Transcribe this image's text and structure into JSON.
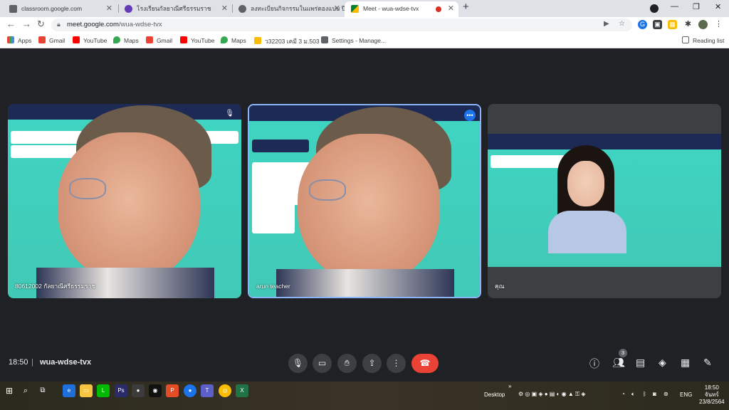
{
  "browser": {
    "tabs": [
      {
        "title": "classroom.google.com",
        "active": false
      },
      {
        "title": "โรงเรียนกัลยาณีศรีธรรมราช",
        "active": false
      },
      {
        "title": "ลงทะเบียนกิจกรรมในแพร่ดองแบบ ปีการศึ",
        "active": false
      },
      {
        "title": "Meet - wua-wdse-tvx",
        "active": true
      }
    ],
    "address": {
      "host": "meet.google.com",
      "path": "/wua-wdse-tvx"
    },
    "bookmarks": [
      "Apps",
      "Gmail",
      "YouTube",
      "Maps",
      "Gmail",
      "YouTube",
      "Maps",
      "ว32203 เคมี 3 ม.503",
      "Settings - Manage..."
    ],
    "reading_list": "Reading list"
  },
  "meet": {
    "participants": [
      {
        "name": "80612002 กัลยาณีศรีธรรมราช"
      },
      {
        "name": "arun teacher"
      },
      {
        "name": "คุณ"
      }
    ],
    "time": "18:50",
    "separator": "|",
    "meeting_code": "wua-wdse-tvx",
    "people_count": "3"
  },
  "taskbar": {
    "desktop_label": "Desktop",
    "lang": "ENG",
    "clock_time": "18:50",
    "clock_day": "จันทร์",
    "clock_date": "23/8/2564"
  },
  "colors": {
    "meet_bg": "#202124",
    "accent": "#1a73e8",
    "end_call": "#ea4335",
    "slide_teal": "#3fd4c1"
  }
}
